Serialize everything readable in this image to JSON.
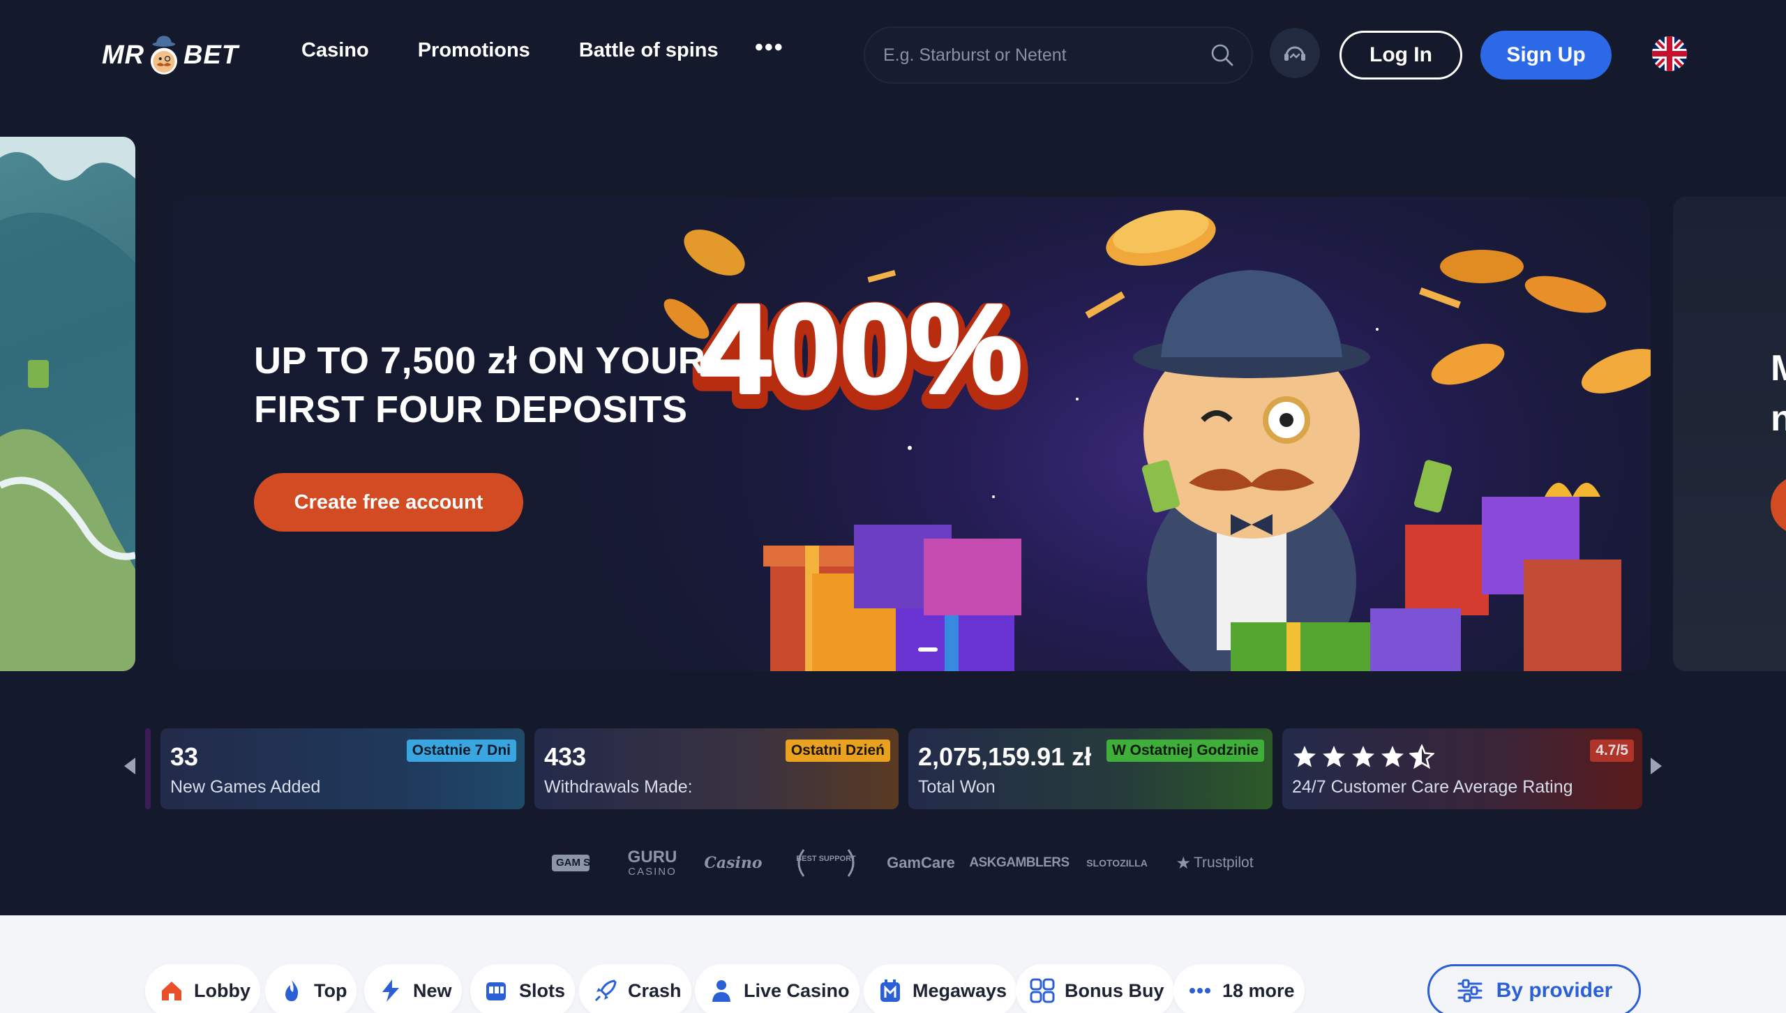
{
  "header": {
    "logo_left": "MR",
    "logo_right": "BET",
    "nav": [
      {
        "label": "Casino"
      },
      {
        "label": "Promotions"
      },
      {
        "label": "Battle of spins"
      }
    ],
    "more_label": "•••",
    "search_placeholder": "E.g. Starburst or Netent",
    "login_label": "Log In",
    "signup_label": "Sign Up",
    "language_icon": "uk-flag-icon"
  },
  "hero": {
    "big_text": "400%",
    "title_line1": "UP TO 7,500 zł ON YOUR",
    "title_line2": "FIRST FOUR DEPOSITS",
    "cta_label": "Create free account",
    "next_slide_text_line1": "M",
    "next_slide_text_line2": "n"
  },
  "stats": [
    {
      "value": "33",
      "label": "New Games Added",
      "badge": "Ostatnie 7 Dni",
      "badge_color": "#39a6e0"
    },
    {
      "value": "433",
      "label": "Withdrawals Made:",
      "badge": "Ostatni Dzień",
      "badge_color": "#e8a21f"
    },
    {
      "value": "2,075,159.91 zł",
      "label": "Total Won",
      "badge": "W Ostatniej Godzinie",
      "badge_color": "#3fae3a"
    },
    {
      "value": "",
      "label": "24/7 Customer Care Average Rating",
      "badge": "4.7/5",
      "badge_color": "#c0392b",
      "rating": 4.5
    }
  ],
  "trust_logos": [
    "GAM STOP",
    "GURU",
    "CASINO",
    "Casino",
    "BEST SUPPORT",
    "GamCare",
    "ASKGAMBLERS",
    "SLOTOZILLA",
    "Trustpilot"
  ],
  "categories": [
    {
      "label": "Lobby",
      "icon": "home-icon"
    },
    {
      "label": "Top",
      "icon": "flame-icon"
    },
    {
      "label": "New",
      "icon": "lightning-icon"
    },
    {
      "label": "Slots",
      "icon": "slot-machine-icon"
    },
    {
      "label": "Crash",
      "icon": "rocket-icon"
    },
    {
      "label": "Live Casino",
      "icon": "person-icon"
    },
    {
      "label": "Megaways",
      "icon": "megaways-icon"
    },
    {
      "label": "Bonus Buy",
      "icon": "bonus-grid-icon"
    },
    {
      "label": "18 more",
      "icon": "more-dots-icon"
    }
  ],
  "provider_label": "By provider",
  "colors": {
    "background": "#141a2c",
    "accent_blue": "#2b69e6",
    "cta_orange": "#d24b22"
  }
}
